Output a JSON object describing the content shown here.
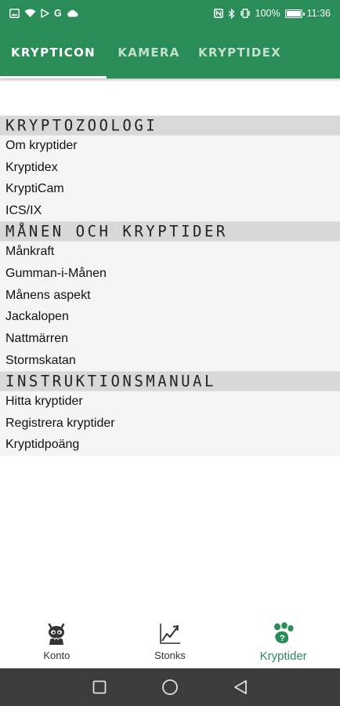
{
  "status_bar": {
    "battery_percent": "100%",
    "time": "11:36",
    "left_icons": [
      "image-icon",
      "wifi-icon",
      "play-store-icon",
      "google-icon",
      "cloud-icon"
    ],
    "right_icons": [
      "nfc-icon",
      "bluetooth-icon",
      "vibrate-icon",
      "battery-icon"
    ],
    "google_letter": "G",
    "battery_level": 1.0
  },
  "tabs": [
    {
      "label": "KRYPTICON",
      "active": true
    },
    {
      "label": "KAMERA",
      "active": false
    },
    {
      "label": "KRYPTIDEX",
      "active": false
    }
  ],
  "sections": [
    {
      "title": "Kryptozoologi",
      "items": [
        "Om kryptider",
        "Kryptidex",
        "KryptiCam",
        "ICS/IX"
      ]
    },
    {
      "title": "Månen och kryptider",
      "items": [
        "Månkraft",
        "Gumman-i-Månen",
        "Månens aspekt",
        "Jackalopen",
        "Nattmärren",
        "Stormskatan"
      ]
    },
    {
      "title": "Instruktionsmanual",
      "items": [
        "Hitta kryptider",
        "Registrera kryptider",
        "Kryptidpoäng"
      ]
    }
  ],
  "bottom_nav": [
    {
      "label": "Konto",
      "icon": "monster-account-icon",
      "active": false
    },
    {
      "label": "Stonks",
      "icon": "stonks-chart-icon",
      "active": false
    },
    {
      "label": "Kryptider",
      "icon": "kryptider-paw-icon",
      "active": true
    }
  ],
  "system_nav": [
    "recents-square-icon",
    "home-circle-icon",
    "back-triangle-icon"
  ],
  "colors": {
    "primary": "#2a8c57",
    "section_bg": "#d8d8d8",
    "item_bg": "#f5f5f5",
    "system_nav_bg": "#3c3c3c"
  }
}
